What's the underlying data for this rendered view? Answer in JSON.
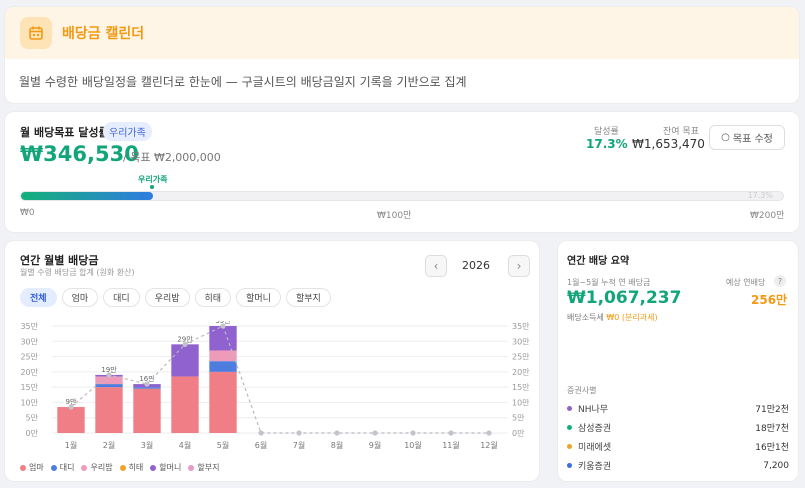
{
  "header": {
    "title": "배당금 캘린더",
    "icon": "calendar-icon",
    "description": "월별 수령한 배당일정을 캘린더로 한눈에 — 구글시트의 배당금일지 기록을 기반으로 집계"
  },
  "goal": {
    "label": "월 배당목표 달성률",
    "badge": "우리가족",
    "amount": "₩346,530",
    "target": "/ 목표 ₩2,000,000",
    "rate_label": "달성률",
    "rate_value": "17.3%",
    "remain_label": "잔여 목표",
    "remain_value": "₩1,653,470",
    "edit_button": "목표 수정",
    "progress_pct": 17.3,
    "progress_text": "17.3%",
    "marker_label": "우리가족",
    "scale": [
      "₩0",
      "₩100만",
      "₩200만"
    ]
  },
  "chart": {
    "title": "연간 월별 배당금",
    "subtitle": "월별 수령 배당금 합계 (원화 환산)",
    "year": "2026",
    "prev_icon": "chevron-left-icon",
    "next_icon": "chevron-right-icon",
    "filters": [
      "전체",
      "엄마",
      "대디",
      "우리밥",
      "히태",
      "할머니",
      "할부지"
    ],
    "active_filter": "전체",
    "legend": [
      {
        "name": "엄마",
        "color": "#f07e87"
      },
      {
        "name": "대디",
        "color": "#4e7de0"
      },
      {
        "name": "우리밥",
        "color": "#ee9bb9"
      },
      {
        "name": "히태",
        "color": "#f2a32a"
      },
      {
        "name": "할머니",
        "color": "#8f62cf"
      },
      {
        "name": "할부지",
        "color": "#e59bc8"
      }
    ]
  },
  "chart_data": {
    "type": "bar",
    "stacked": true,
    "categories": [
      "1월",
      "2월",
      "3월",
      "4월",
      "5월",
      "6월",
      "7월",
      "8월",
      "9월",
      "10월",
      "11월",
      "12월"
    ],
    "y_ticks": [
      "0만",
      "5만",
      "10만",
      "15만",
      "20만",
      "25만",
      "30만",
      "35만"
    ],
    "ylim": [
      0,
      35
    ],
    "unit": "만원",
    "series": [
      {
        "name": "엄마",
        "color": "#f07e87",
        "values": [
          8.5,
          15,
          14.5,
          18.5,
          20,
          0,
          0,
          0,
          0,
          0,
          0,
          0
        ]
      },
      {
        "name": "대디",
        "color": "#4e7de0",
        "values": [
          0,
          1,
          0.5,
          0,
          3.5,
          0,
          0,
          0,
          0,
          0,
          0,
          0
        ]
      },
      {
        "name": "우리밥",
        "color": "#ee9bb9",
        "values": [
          0,
          2.5,
          0,
          0,
          3.5,
          0,
          0,
          0,
          0,
          0,
          0,
          0
        ]
      },
      {
        "name": "할머니",
        "color": "#8f62cf",
        "values": [
          0,
          0.5,
          1,
          10.5,
          8,
          0,
          0,
          0,
          0,
          0,
          0,
          0
        ]
      }
    ],
    "total_labels": [
      "9만",
      "19만",
      "16만",
      "29만",
      "35만",
      "",
      "",
      "",
      "",
      "",
      "",
      ""
    ],
    "totals": [
      8.5,
      19,
      16,
      29,
      35,
      0,
      0,
      0,
      0,
      0,
      0,
      0
    ],
    "grid": true,
    "trend_line": true
  },
  "summary": {
    "title": "연간 배당 요약",
    "period_label": "1월~5월 누적 연 배당금",
    "amount": "₩1,067,237",
    "tax_label": "배당소득세",
    "tax_value": "₩0 (분리과세)",
    "annual_label": "예상 연배당",
    "annual_value": "256만",
    "help_icon": "question-icon",
    "broker_label": "증권사별",
    "brokers": [
      {
        "name": "NH나무",
        "value": "71만2천",
        "color": "#8f62cf"
      },
      {
        "name": "삼성증권",
        "value": "18만7천",
        "color": "#14b07a"
      },
      {
        "name": "미래에셋",
        "value": "16만1천",
        "color": "#f2a32a"
      },
      {
        "name": "키움증권",
        "value": "7,200",
        "color": "#3a6fe0"
      }
    ]
  }
}
